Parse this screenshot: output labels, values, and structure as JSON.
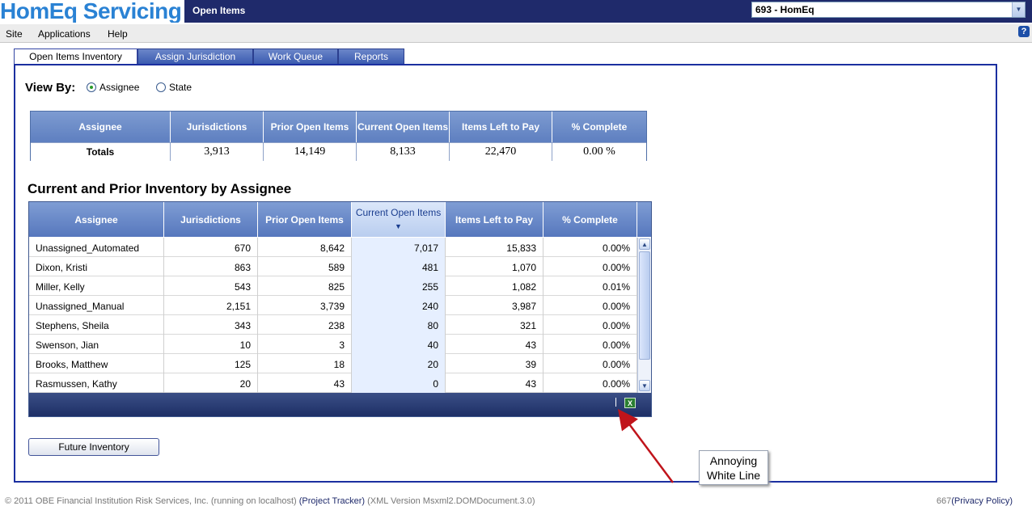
{
  "header": {
    "logo_text": "HomEq Servicing",
    "page_title": "Open Items",
    "company_selected": "693 - HomEq"
  },
  "menu": {
    "items": [
      "Site",
      "Applications",
      "Help"
    ],
    "help_glyph": "?"
  },
  "tabs": [
    {
      "label": "Open Items Inventory",
      "active": true
    },
    {
      "label": "Assign Jurisdiction",
      "active": false
    },
    {
      "label": "Work Queue",
      "active": false
    },
    {
      "label": "Reports",
      "active": false
    }
  ],
  "view_by": {
    "label": "View By:",
    "options": [
      {
        "label": "Assignee",
        "checked": true
      },
      {
        "label": "State",
        "checked": false
      }
    ]
  },
  "totals_table": {
    "headers": [
      "Assignee",
      "Jurisdictions",
      "Prior Open Items",
      "Current Open Items",
      "Items Left to Pay",
      "% Complete"
    ],
    "row": [
      "Totals",
      "3,913",
      "14,149",
      "8,133",
      "22,470",
      "0.00 %"
    ]
  },
  "inventory": {
    "title": "Current and Prior Inventory by Assignee",
    "headers": [
      "Assignee",
      "Jurisdictions",
      "Prior Open Items",
      "Current Open Items",
      "Items Left to Pay",
      "% Complete"
    ],
    "sort_glyph": "▼",
    "rows": [
      [
        "Unassigned_Automated",
        "670",
        "8,642",
        "7,017",
        "15,833",
        "0.00%"
      ],
      [
        "Dixon, Kristi",
        "863",
        "589",
        "481",
        "1,070",
        "0.00%"
      ],
      [
        "Miller, Kelly",
        "543",
        "825",
        "255",
        "1,082",
        "0.01%"
      ],
      [
        "Unassigned_Manual",
        "2,151",
        "3,739",
        "240",
        "3,987",
        "0.00%"
      ],
      [
        "Stephens, Sheila",
        "343",
        "238",
        "80",
        "321",
        "0.00%"
      ],
      [
        "Swenson, Jian",
        "10",
        "3",
        "40",
        "43",
        "0.00%"
      ],
      [
        "Brooks, Matthew",
        "125",
        "18",
        "20",
        "39",
        "0.00%"
      ],
      [
        "Rasmussen, Kathy",
        "20",
        "43",
        "0",
        "43",
        "0.00%"
      ]
    ]
  },
  "buttons": {
    "future_inventory": "Future Inventory"
  },
  "callout": {
    "line1": "Annoying",
    "line2": "White Line"
  },
  "footer": {
    "copyright": "© 2011 OBE Financial Institution Risk Services, Inc. (running on localhost) ",
    "project_link": "(Project Tracker)",
    "xml_version": " (XML Version Msxml2.DOMDocument.3.0)",
    "right_number": "667",
    "privacy_link": "(Privacy Policy)"
  },
  "colors": {
    "header_bg": "#1f2a6b",
    "logo_blue": "#2a82d4",
    "frame_border": "#1b2fa0",
    "arrow_red": "#c0141b"
  }
}
